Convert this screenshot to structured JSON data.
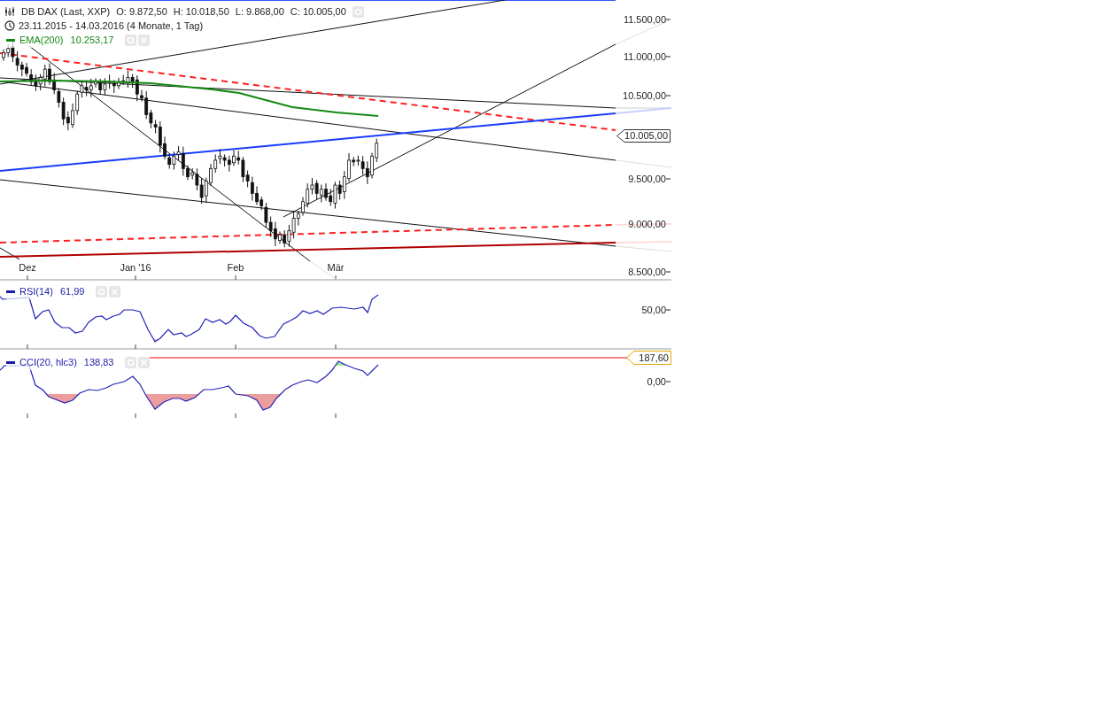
{
  "legend": {
    "instrument": "DB DAX (Last, XXP)",
    "quote": [
      {
        "label": "O:",
        "value": "9.872,50"
      },
      {
        "label": "H:",
        "value": "10.018,50"
      },
      {
        "label": "L:",
        "value": "9.868,00"
      },
      {
        "label": "C:",
        "value": "10.005,00"
      }
    ],
    "period": "23.11.2015 - 14.03.2016 (4 Monate, 1 Tag)"
  },
  "indicators": [
    {
      "kind": "ema",
      "label": "EMA(200)",
      "value": "10.253,17"
    },
    {
      "kind": "rsi",
      "label": "RSI(14)",
      "value": "61,99"
    },
    {
      "kind": "cci",
      "label": "CCI(20, hlc3)",
      "value": "138,83"
    }
  ],
  "price_axis": [
    "11.500,00",
    "11.000,00",
    "10.500,00",
    "9.500,00",
    "9.000,00",
    "8.500,00"
  ],
  "current_price": "10.005,00",
  "time_axis": [
    "Dez",
    "Jan '16",
    "Feb",
    "Mär"
  ],
  "rsi_axis": [
    "50,00"
  ],
  "cci_axis": [
    "0,00"
  ],
  "cci_marker": "187,60"
}
